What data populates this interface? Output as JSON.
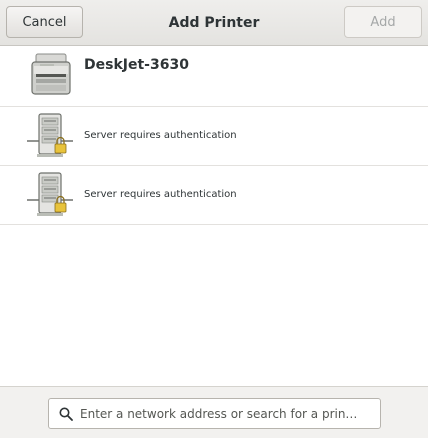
{
  "header": {
    "title": "Add Printer",
    "cancel_label": "Cancel",
    "add_label": "Add"
  },
  "printers": [
    {
      "name": "DeskJet-3630",
      "status": "",
      "icon": "printer-icon"
    },
    {
      "name": "",
      "status": "Server requires authentication",
      "icon": "network-printer-locked-icon"
    },
    {
      "name": "",
      "status": "Server requires authentication",
      "icon": "network-printer-locked-icon"
    }
  ],
  "search": {
    "placeholder": "Enter a network address or search for a prin…",
    "value": "",
    "icon": "search-icon"
  },
  "colors": {
    "headerbar": "#e8e7e5",
    "text": "#2e3436",
    "disabled_text": "#a5a8a8",
    "lock": "#e8c33b"
  }
}
